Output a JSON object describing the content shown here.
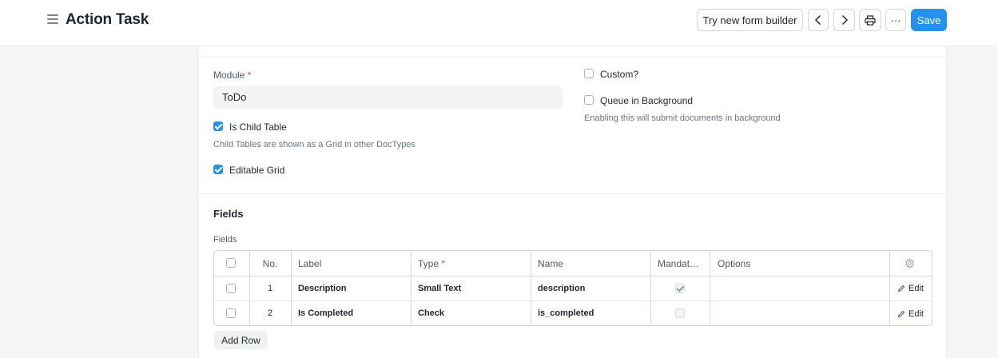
{
  "header": {
    "title": "Action Task",
    "form_builder_label": "Try new form builder",
    "more_label": "···",
    "save_label": "Save"
  },
  "form": {
    "module_label": "Module",
    "module_required_mark": "*",
    "module_value": "ToDo",
    "is_child_table_label": "Is Child Table",
    "is_child_table_checked": true,
    "is_child_table_help": "Child Tables are shown as a Grid in other DocTypes",
    "editable_grid_label": "Editable Grid",
    "editable_grid_checked": true,
    "custom_label": "Custom?",
    "custom_checked": false,
    "queue_label": "Queue in Background",
    "queue_checked": false,
    "queue_help": "Enabling this will submit documents in background"
  },
  "fields_section": {
    "title": "Fields",
    "grid_label": "Fields",
    "columns": [
      "No.",
      "Label",
      "Type",
      "Name",
      "Mandat…",
      "Options"
    ],
    "type_required_mark": "*",
    "rows": [
      {
        "no": "1",
        "label": "Description",
        "type": "Small Text",
        "name": "description",
        "mandatory": true,
        "options": "",
        "edit": "Edit"
      },
      {
        "no": "2",
        "label": "Is Completed",
        "type": "Check",
        "name": "is_completed",
        "mandatory": false,
        "options": "",
        "edit": "Edit"
      }
    ],
    "add_row_label": "Add Row"
  },
  "colors": {
    "primary": "#2490ef",
    "required": "#e24c4c"
  },
  "icons": [
    "menu-icon",
    "chevron-left-icon",
    "chevron-right-icon",
    "printer-icon",
    "gear-icon",
    "pencil-icon"
  ]
}
